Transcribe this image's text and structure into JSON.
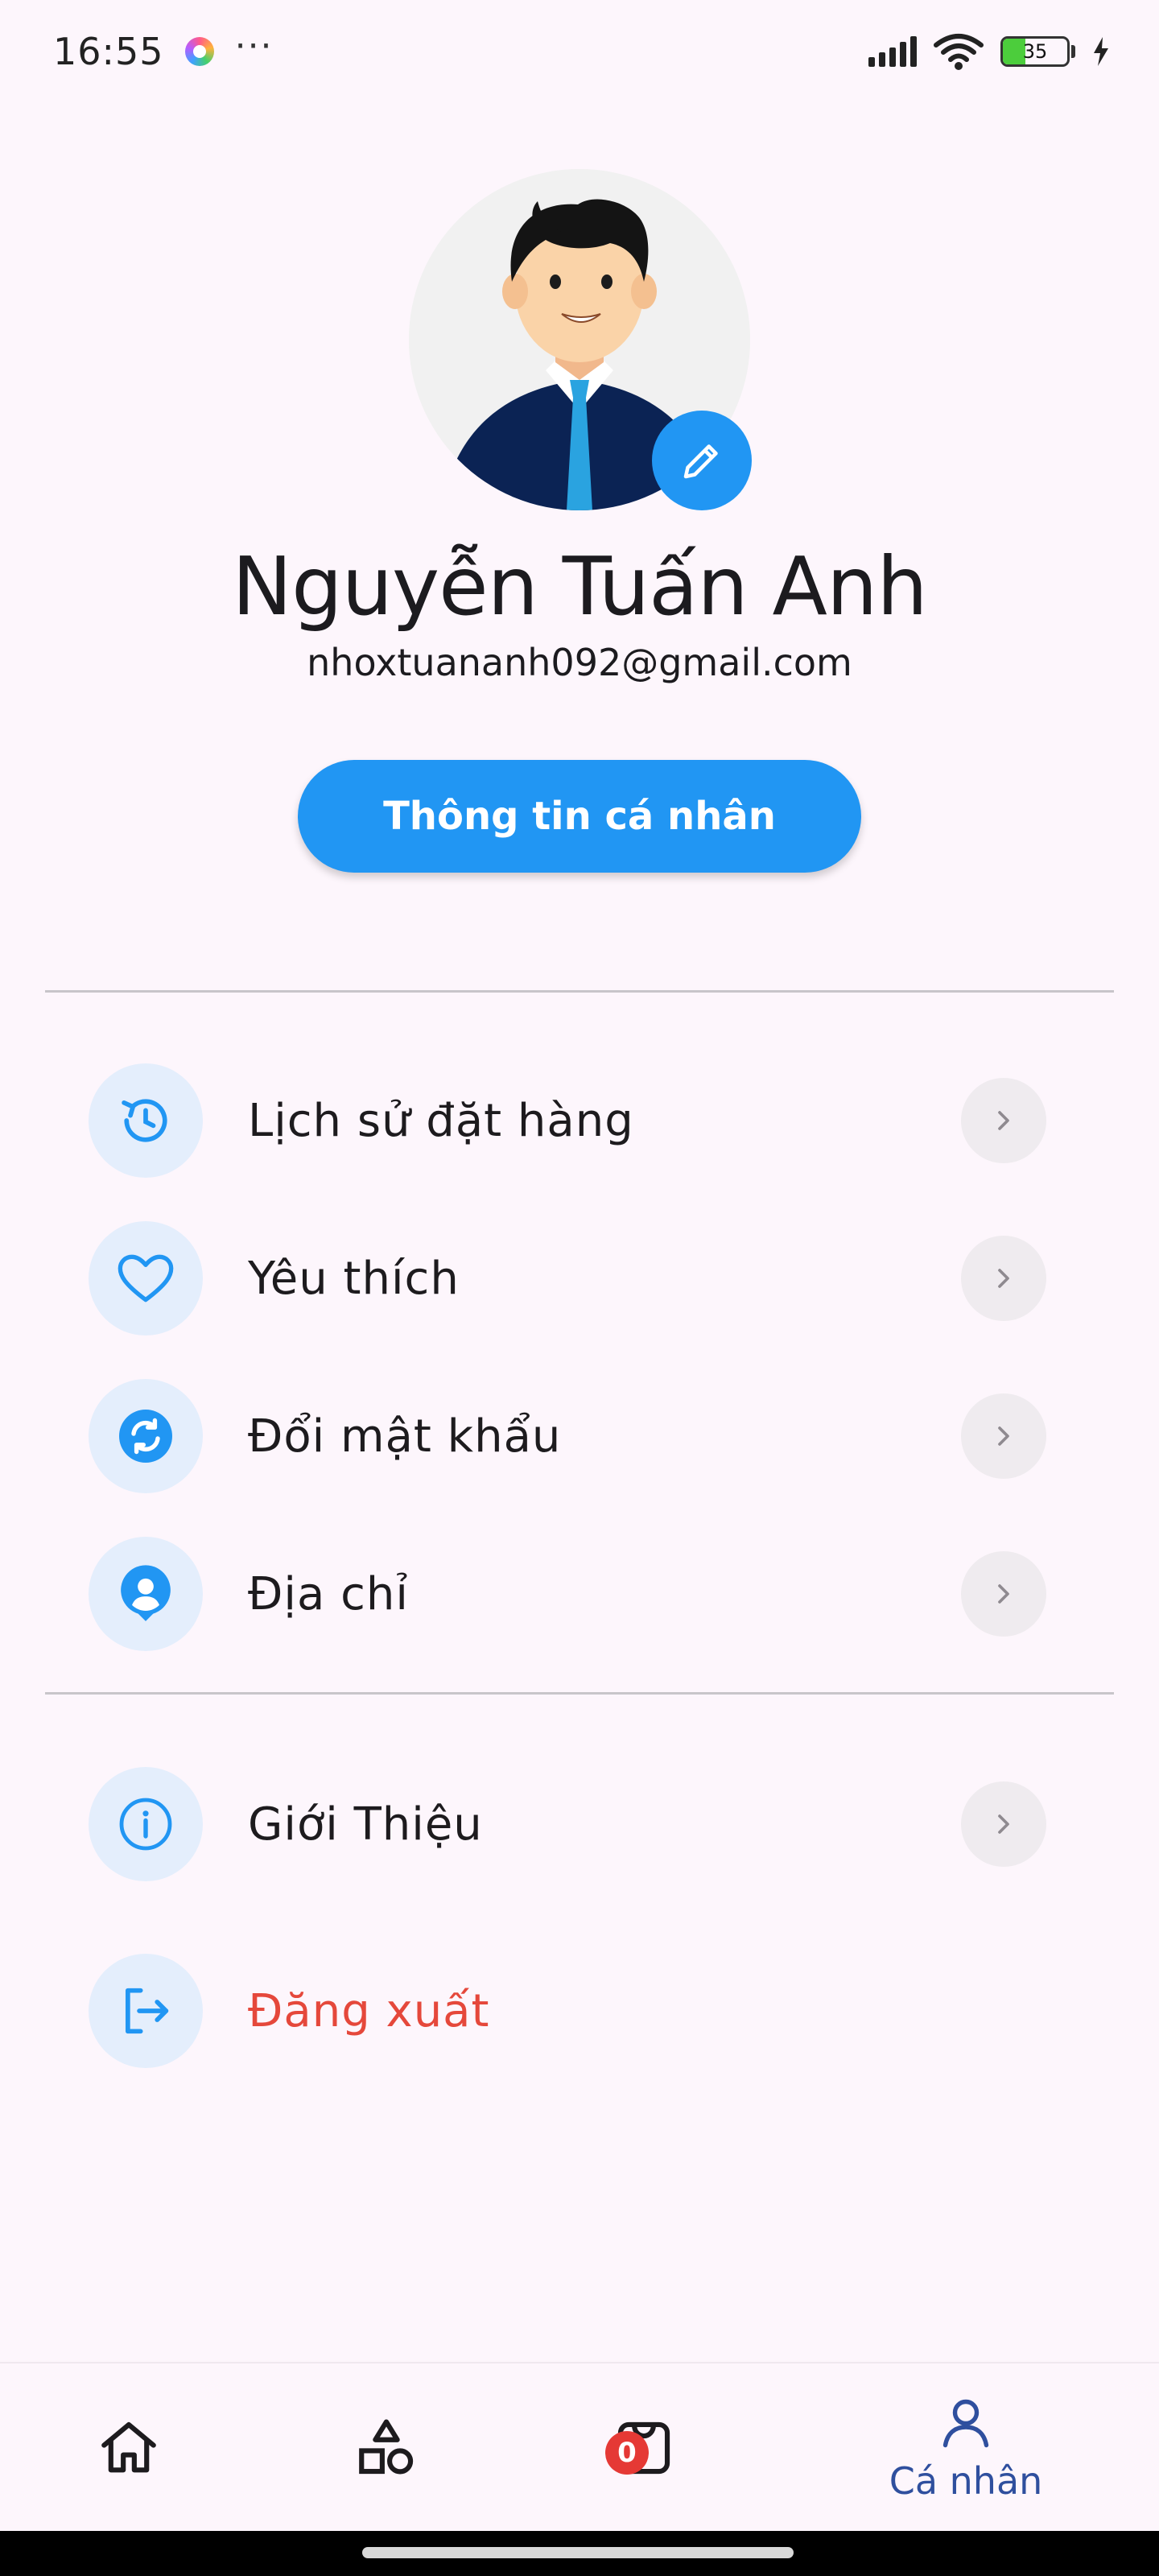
{
  "status_bar": {
    "time": "16:55",
    "overflow_dots": "···",
    "battery_level": "35",
    "icons": [
      "app-notification-icon",
      "signal-icon",
      "wifi-icon",
      "battery-icon",
      "charging-icon"
    ]
  },
  "profile": {
    "name": "Nguyễn Tuấn Anh",
    "email": "nhoxtuananh092@gmail.com",
    "personal_info_button": "Thông tin cá nhân"
  },
  "menu": {
    "items": [
      {
        "label": "Lịch sử đặt hàng",
        "icon": "history-icon"
      },
      {
        "label": "Yêu thích",
        "icon": "heart-icon"
      },
      {
        "label": "Đổi mật khẩu",
        "icon": "sync-icon"
      },
      {
        "label": "Địa chỉ",
        "icon": "person-pin-icon"
      },
      {
        "label": "Giới Thiệu",
        "icon": "info-icon"
      },
      {
        "label": "Đăng xuất",
        "icon": "logout-icon"
      }
    ]
  },
  "bottom_nav": {
    "items": [
      {
        "label": "",
        "icon": "home-icon"
      },
      {
        "label": "",
        "icon": "categories-icon"
      },
      {
        "label": "",
        "icon": "shopping-bag-icon"
      },
      {
        "label": "Cá nhân",
        "icon": "person-icon"
      }
    ],
    "cart_count": "0",
    "active_index": 3
  },
  "colors": {
    "primary": "#2196f3",
    "icon_bg": "#e4eefc",
    "logout": "#e5483b",
    "nav_active": "#2f4f9e",
    "background": "#fdf6fc"
  }
}
